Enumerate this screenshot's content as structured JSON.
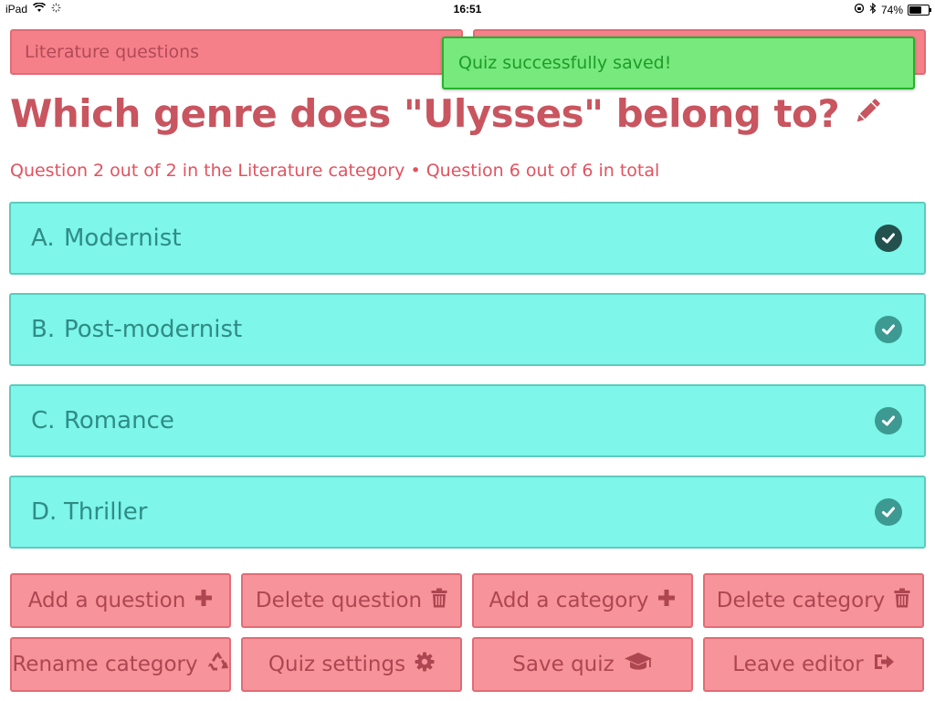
{
  "status_bar": {
    "device": "iPad",
    "time": "16:51",
    "battery": "74%",
    "battery_level": 0.74
  },
  "category_selector": {
    "selected": "Literature questions"
  },
  "toast": {
    "message": "Quiz successfully saved!"
  },
  "question": {
    "title": "Which genre does \"Ulysses\" belong to?",
    "subtitle": "Question 2 out of 2 in the Literature category • Question 6 out of 6 in total"
  },
  "answers": [
    {
      "letter": "A.",
      "text": "Modernist",
      "correct": true
    },
    {
      "letter": "B.",
      "text": "Post-modernist",
      "correct": false
    },
    {
      "letter": "C.",
      "text": "Romance",
      "correct": false
    },
    {
      "letter": "D.",
      "text": "Thriller",
      "correct": false
    }
  ],
  "buttons": {
    "add_question": "Add a question",
    "delete_question": "Delete question",
    "add_category": "Add a category",
    "delete_category": "Delete category",
    "rename_category": "Rename category",
    "quiz_settings": "Quiz settings",
    "save_quiz": "Save quiz",
    "leave_editor": "Leave editor"
  },
  "icons": {
    "edit": "pencil-icon",
    "add": "plus-icon",
    "delete": "trash-icon",
    "rename": "recycle-icon",
    "settings": "gear-icon",
    "save": "graduation-cap-icon",
    "leave": "sign-out-icon",
    "check": "check-circle-icon"
  },
  "colors": {
    "accent": "#c8555f",
    "button_bg": "#f7939b",
    "answer_bg": "#7ef6ea",
    "toast_bg": "#78e97c",
    "correct_check": "#23524e"
  }
}
